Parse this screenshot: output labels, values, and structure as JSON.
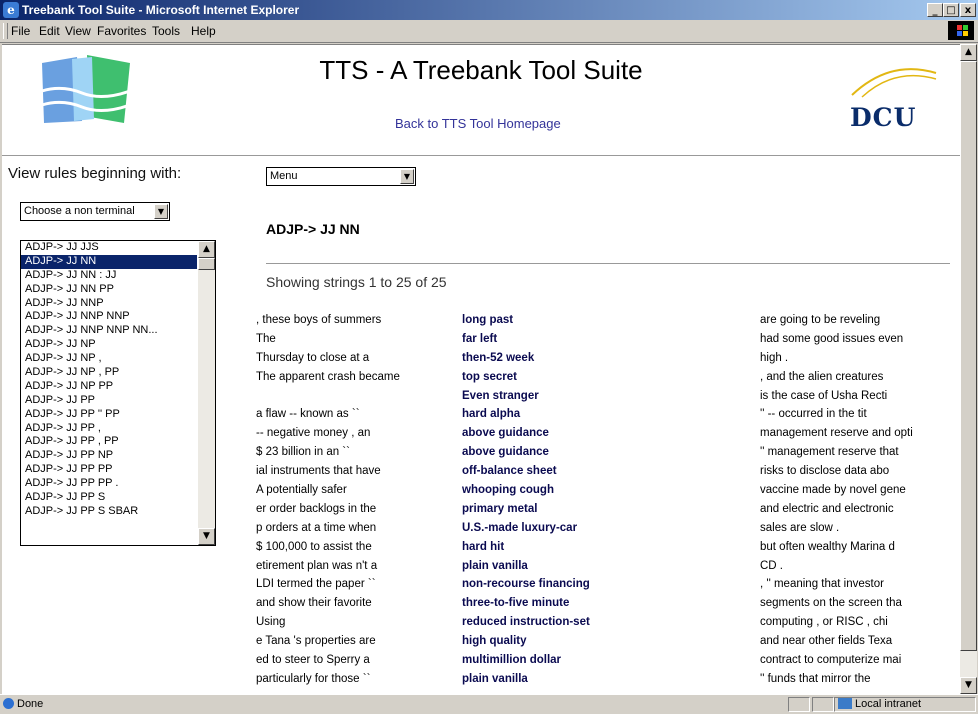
{
  "window": {
    "title": "Treebank Tool Suite - Microsoft Internet Explorer",
    "buttons": [
      "_",
      "□",
      "x"
    ]
  },
  "menubar": [
    "File",
    "Edit",
    "View",
    "Favorites",
    "Tools",
    "Help"
  ],
  "header": {
    "title": "TTS - A Treebank Tool Suite",
    "home_link": "Back to TTS Tool Homepage",
    "dcu_logo_text": "DCU"
  },
  "left": {
    "heading": "View rules beginning with:",
    "nonterminal_select": "Choose a non terminal",
    "rules": [
      "ADJP-> JJ JJS",
      "ADJP-> JJ NN",
      "ADJP-> JJ NN : JJ",
      "ADJP-> JJ NN PP",
      "ADJP-> JJ NNP",
      "ADJP-> JJ NNP NNP",
      "ADJP-> JJ NNP NNP NN...",
      "ADJP-> JJ NP",
      "ADJP-> JJ NP ,",
      "ADJP-> JJ NP , PP",
      "ADJP-> JJ NP PP",
      "ADJP-> JJ PP",
      "ADJP-> JJ PP '' PP",
      "ADJP-> JJ PP ,",
      "ADJP-> JJ PP , PP",
      "ADJP-> JJ PP NP",
      "ADJP-> JJ PP PP",
      "ADJP-> JJ PP PP .",
      "ADJP-> JJ PP S",
      "ADJP-> JJ PP S SBAR"
    ],
    "selected_index": 1
  },
  "main": {
    "menu_select": "Menu",
    "rule_title": "ADJP-> JJ NN",
    "showing": "Showing strings 1 to 25 of 25",
    "left_context": [
      ", these boys of summers",
      "The",
      "Thursday to close at a",
      "The apparent crash became",
      "",
      "a flaw -- known as ``",
      "-- negative money , an",
      "$ 23 billion in an ``",
      "ial instruments that have",
      "A potentially safer",
      "er order backlogs in the",
      "p orders at a time when",
      "$ 100,000 to assist the",
      "etirement plan was n't a",
      "LDI termed the paper ``",
      "and show their favorite",
      "Using",
      "e Tana 's properties are",
      "ed to steer to Sperry a",
      "particularly for those ``"
    ],
    "matches": [
      "long past",
      "far left",
      "then-52 week",
      "top secret",
      "Even stranger",
      "hard alpha",
      "above guidance",
      "above guidance",
      "off-balance sheet",
      "whooping cough",
      "primary metal",
      "U.S.-made luxury-car",
      "hard hit",
      "plain vanilla",
      "non-recourse financing",
      "three-to-five minute",
      "reduced instruction-set",
      "high quality",
      "multimillion dollar",
      "plain vanilla"
    ],
    "right_context": [
      "are going to be reveling",
      "had some good issues even",
      "high .",
      ", and the alien creatures",
      "is the case of Usha Recti",
      "'' -- occurred in the tit",
      "management reserve and opti",
      "'' management reserve that",
      "risks to disclose data abo",
      "vaccine made by novel gene",
      "and electric and electronic",
      "sales are slow .",
      "but often wealthy Marina d",
      "CD .",
      ", '' meaning that investor",
      "segments on the screen tha",
      "computing , or RISC , chi",
      "and near other fields Texa",
      "contract to computerize mai",
      "'' funds that mirror the"
    ]
  },
  "statusbar": {
    "status": "Done",
    "zone": "Local intranet"
  }
}
